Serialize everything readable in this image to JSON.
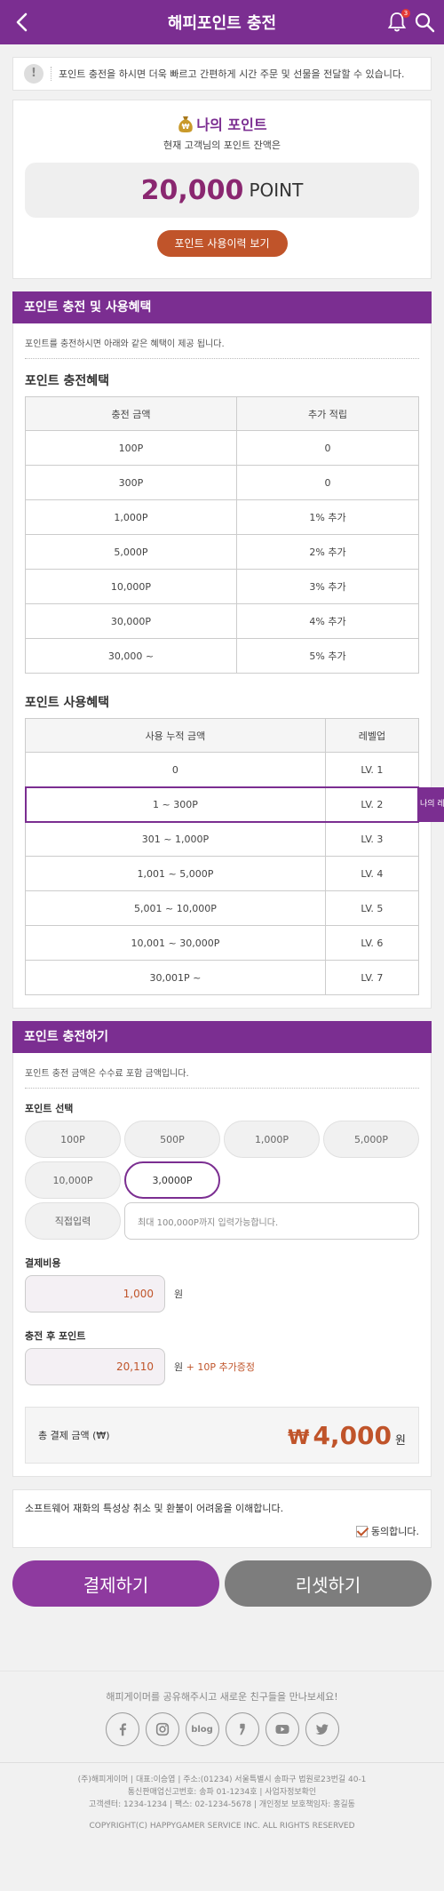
{
  "header": {
    "title": "해피포인트 충전",
    "bell_badge": "3",
    "icons": [
      "back-arrow-icon",
      "bell-icon",
      "search-icon"
    ]
  },
  "notice": {
    "text": "포인트 충전을 하시면 더욱 빠르고 간편하게 시간 주문 및 선물을 전달할 수 있습니다."
  },
  "my_point": {
    "title": "나의 포인트",
    "subtitle": "현재 고객님의 포인트 잔액은",
    "amount": "20,000",
    "unit": "POINT",
    "history_button": "포인트 사용이력 보기"
  },
  "benefits": {
    "header": "포인트 충전 및 사용혜택",
    "desc": "포인트를 충전하시면 아래와 같은 혜택이 제공 됩니다.",
    "charge_title": "포인트 충전혜택",
    "charge_cols": [
      "충전 금액",
      "추가 적립"
    ],
    "charge_rows": [
      [
        "100P",
        "0"
      ],
      [
        "300P",
        "0"
      ],
      [
        "1,000P",
        "1% 추가"
      ],
      [
        "5,000P",
        "2% 추가"
      ],
      [
        "10,000P",
        "3% 추가"
      ],
      [
        "30,000P",
        "4% 추가"
      ],
      [
        "30,000 ~",
        "5% 추가"
      ]
    ],
    "use_title": "포인트 사용혜택",
    "use_cols": [
      "사용 누적 금액",
      "레벨업"
    ],
    "use_rows": [
      [
        "0",
        "LV. 1"
      ],
      [
        "1 ~ 300P",
        "LV. 2"
      ],
      [
        "301 ~ 1,000P",
        "LV. 3"
      ],
      [
        "1,001 ~ 5,000P",
        "LV. 4"
      ],
      [
        "5,001 ~ 10,000P",
        "LV. 5"
      ],
      [
        "10,001 ~ 30,000P",
        "LV. 6"
      ],
      [
        "30,001P ~",
        "LV. 7"
      ]
    ],
    "my_level_tag": "나의 레벨"
  },
  "charge": {
    "header": "포인트 충전하기",
    "desc": "포인트 충전 금액은 수수료 포함 금액입니다.",
    "select_label": "포인트 선택",
    "options": [
      "100P",
      "500P",
      "1,000P",
      "5,000P",
      "10,000P",
      "3,0000P"
    ],
    "selected_option": "3,0000P",
    "direct_label": "직접입력",
    "direct_placeholder": "최대 100,000P까지 입력가능합니다.",
    "cost_label": "결제비용",
    "cost_value": "1,000",
    "cost_unit": "원",
    "after_label": "충전 후 포인트",
    "after_value": "20,110",
    "after_unit": "원",
    "after_bonus": "+ 10P 추가증정",
    "total_label": "총 결제 금액 (₩)",
    "total_currency": "₩",
    "total_amount": "4,000",
    "total_unit": "원"
  },
  "agreement": {
    "text": "소프트웨어 재화의 특성상 취소 및 환불이 어려움을 이해합니다.",
    "check_label": "동의합니다.",
    "checked": true
  },
  "actions": {
    "pay": "결제하기",
    "reset": "리셋하기"
  },
  "footer": {
    "share": "해피게이머를 공유해주시고 새로운 친구들을 만나보세요!",
    "social": [
      "facebook-icon",
      "instagram-icon",
      "blog-icon",
      "kakao-story-icon",
      "youtube-icon",
      "twitter-icon"
    ],
    "blog_label": "blog",
    "info_1": "(주)해피게이머 | 대표:이승엽 | 주소:(01234) 서울특별시 송파구 법원로23번길 40-1",
    "info_2": "통신판매업신고번호: 송파 01-1234호 | 사업자정보확인",
    "info_3": "고객센터: 1234-1234 | 팩스: 02-1234-5678 | 개인정보 보호책임자: 홍길동",
    "copyright": "COPYRIGHT(C) HAPPYGAMER SERVICE INC. ALL RIGHTS RESERVED"
  },
  "colors": {
    "primary": "#7b2e91",
    "accent": "#c0542a",
    "reset_button": "#7d7d7d"
  }
}
